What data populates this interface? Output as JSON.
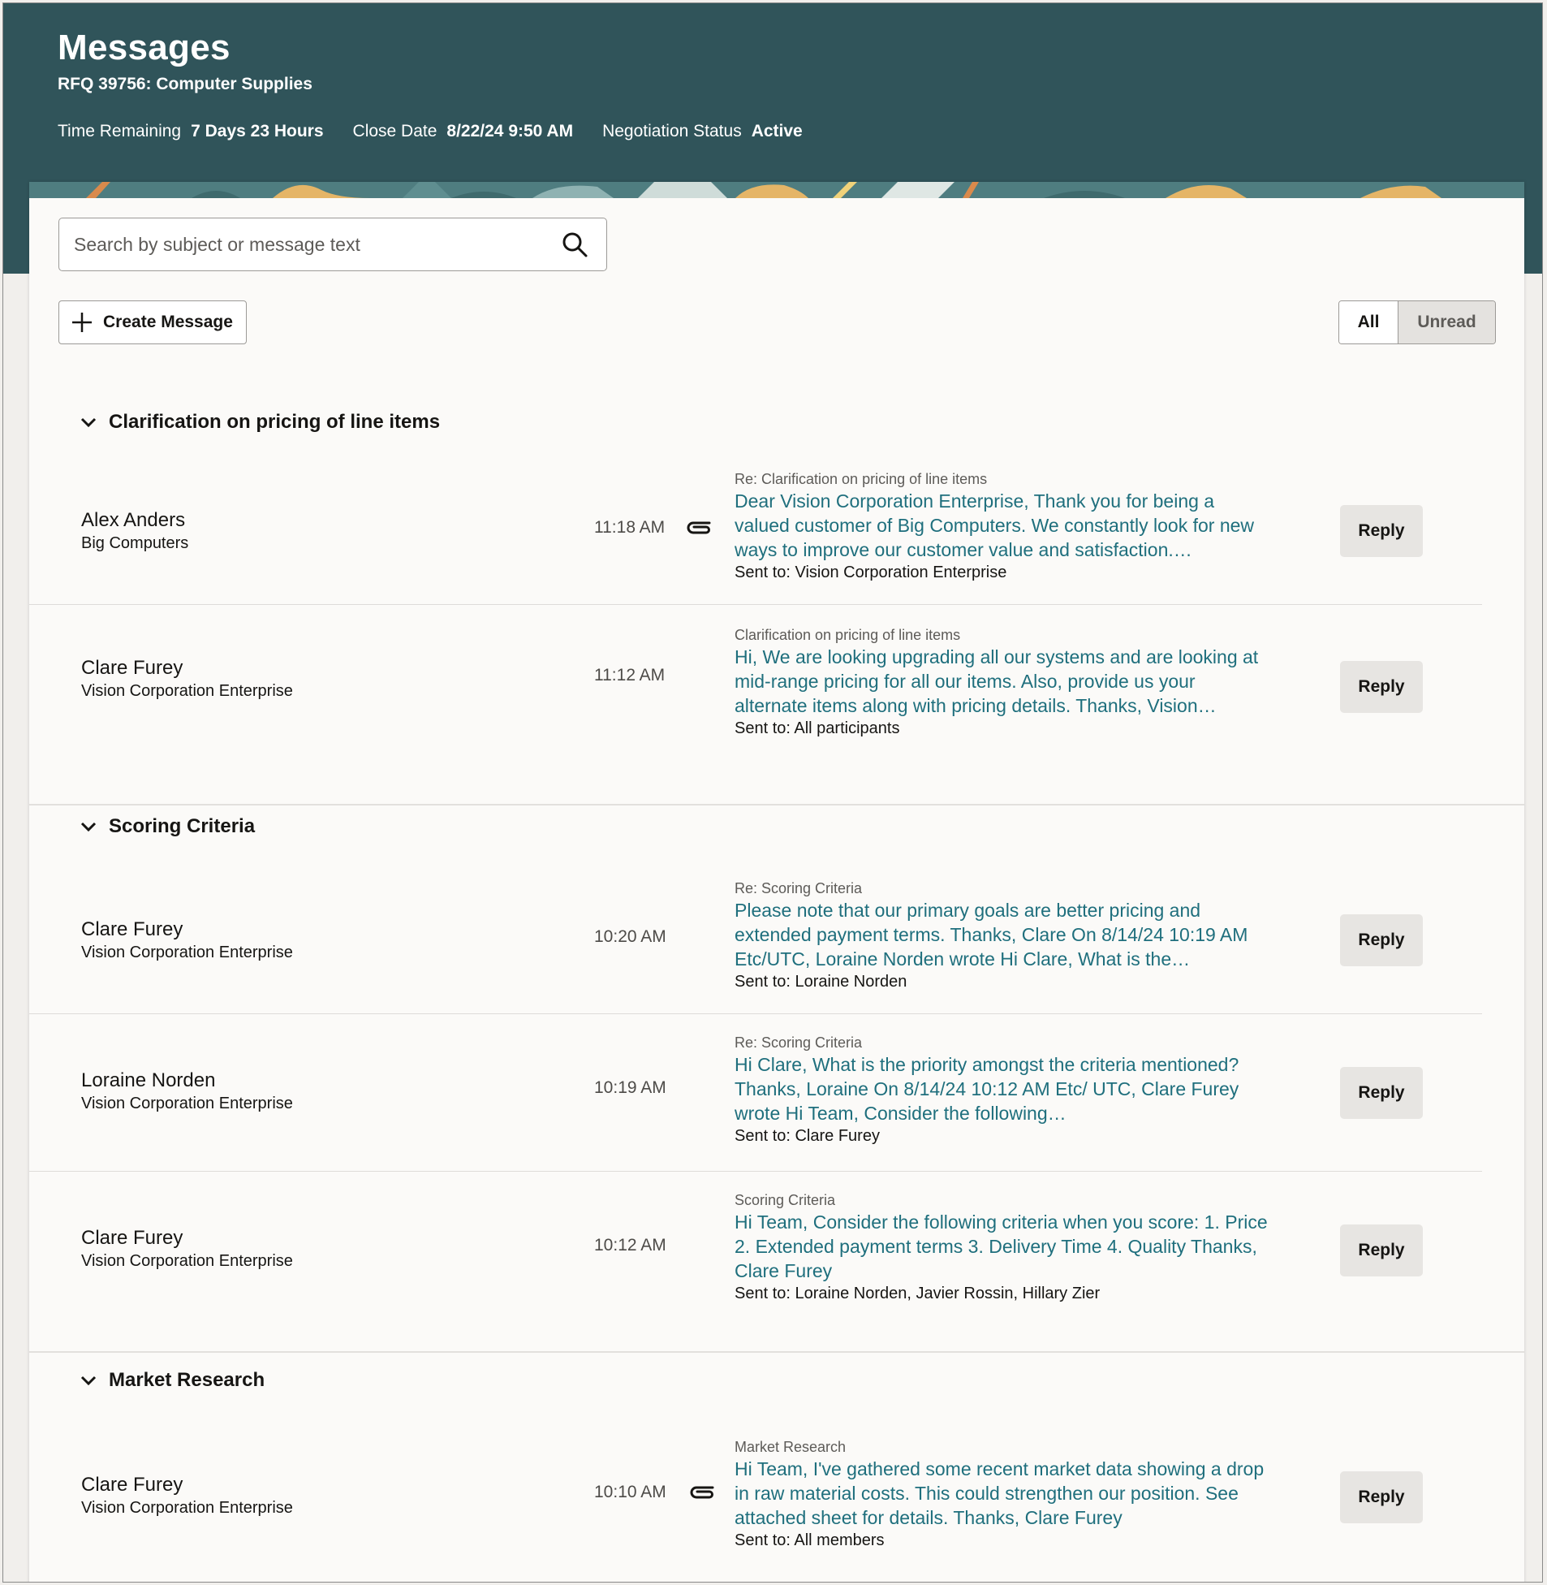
{
  "header": {
    "title": "Messages",
    "subtitle": "RFQ 39756: Computer Supplies",
    "time_remaining_label": "Time Remaining",
    "time_remaining_value": "7 Days 23 Hours",
    "close_date_label": "Close Date",
    "close_date_value": "8/22/24 9:50 AM",
    "negotiation_status_label": "Negotiation Status",
    "negotiation_status_value": "Active"
  },
  "search": {
    "placeholder": "Search by subject or message text"
  },
  "toolbar": {
    "create_label": "Create Message"
  },
  "filter": {
    "all_label": "All",
    "unread_label": "Unread",
    "selected": "All"
  },
  "groups": [
    {
      "title": "Clarification on pricing of line items",
      "messages": [
        {
          "sender": "Alex Anders",
          "org": "Big Computers",
          "time": "11:18 AM",
          "attachment": true,
          "subject": "Re: Clarification on pricing of line items",
          "body": "Dear Vision Corporation Enterprise, Thank you for being a valued customer of Big Computers. We constantly look for new ways to improve our customer value and satisfaction.…",
          "sent_to": "Sent to: Vision Corporation Enterprise",
          "reply_label": "Reply"
        },
        {
          "sender": "Clare Furey",
          "org": "Vision Corporation Enterprise",
          "time": "11:12 AM",
          "attachment": false,
          "subject": "Clarification on pricing of line items",
          "body": "Hi, We are looking upgrading all our systems and are looking at mid-range pricing for all our items. Also, provide us your alternate items along with pricing details. Thanks, Vision…",
          "sent_to": "Sent to: All participants",
          "reply_label": "Reply"
        }
      ]
    },
    {
      "title": "Scoring Criteria",
      "messages": [
        {
          "sender": "Clare Furey",
          "org": "Vision Corporation Enterprise",
          "time": "10:20 AM",
          "attachment": false,
          "subject": "Re: Scoring Criteria",
          "body": "Please note that our primary goals are better pricing and extended payment terms. Thanks, Clare On 8/14/24 10:19 AM Etc/UTC, Loraine Norden wrote Hi Clare, What is the…",
          "sent_to": "Sent to: Loraine Norden",
          "reply_label": "Reply"
        },
        {
          "sender": "Loraine Norden",
          "org": "Vision Corporation Enterprise",
          "time": "10:19 AM",
          "attachment": false,
          "subject": "Re: Scoring Criteria",
          "body": "Hi Clare, What is the priority amongst the criteria mentioned? Thanks, Loraine On 8/14/24 10:12 AM Etc/ UTC, Clare Furey wrote Hi Team, Consider the following…",
          "sent_to": "Sent to: Clare Furey",
          "reply_label": "Reply"
        },
        {
          "sender": "Clare Furey",
          "org": "Vision Corporation Enterprise",
          "time": "10:12 AM",
          "attachment": false,
          "subject": "Scoring Criteria",
          "body": "Hi Team, Consider the following criteria when you score: 1. Price  2. Extended payment terms 3. Delivery Time 4. Quality Thanks, Clare Furey",
          "sent_to": "Sent to: Loraine Norden, Javier Rossin, Hillary Zier",
          "reply_label": "Reply"
        }
      ]
    },
    {
      "title": "Market Research",
      "messages": [
        {
          "sender": "Clare Furey",
          "org": "Vision Corporation Enterprise",
          "time": "10:10 AM",
          "attachment": true,
          "subject": "Market Research",
          "body": "Hi Team, I've gathered some recent market data showing a drop in raw material costs. This could strengthen our position. See attached sheet for details. Thanks, Clare Furey",
          "sent_to": "Sent to: All members",
          "reply_label": "Reply"
        }
      ]
    }
  ],
  "icons": {
    "search": "search-icon",
    "create": "plus-icon",
    "group_toggle": "chevron-down-icon",
    "attachment": "paperclip-icon"
  },
  "colors": {
    "header_bg": "#30545a",
    "link_text": "#1f6f7d",
    "card_bg": "#fbfaf8"
  }
}
